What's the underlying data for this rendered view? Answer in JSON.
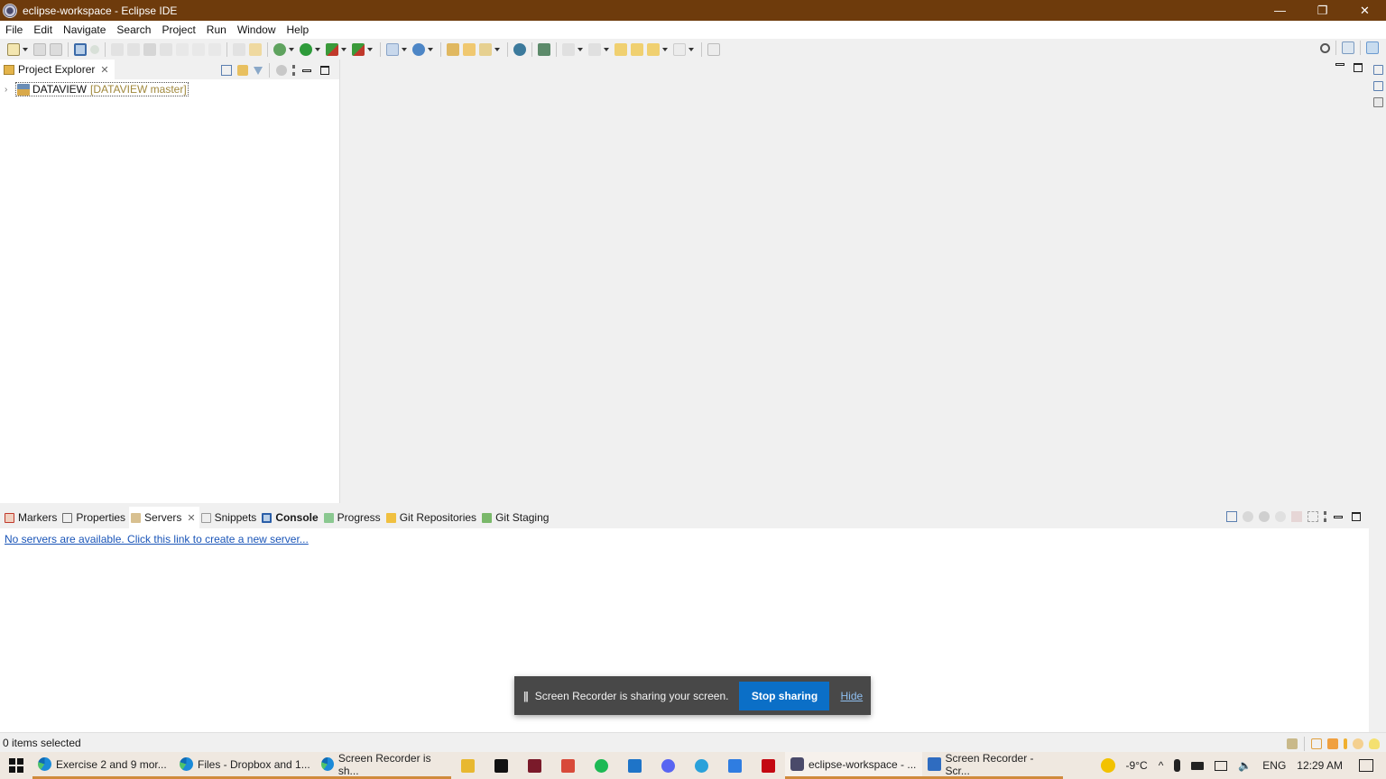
{
  "window": {
    "title": "eclipse-workspace - Eclipse IDE",
    "controls": {
      "minimize": "—",
      "restore": "❐",
      "close": "✕"
    }
  },
  "menu": {
    "items": [
      "File",
      "Edit",
      "Navigate",
      "Search",
      "Project",
      "Run",
      "Window",
      "Help"
    ]
  },
  "toolbar": {
    "left_icons": [
      "new-icon",
      "save-icon",
      "save-all-icon",
      "terminal-icon",
      "skip-breakpoints-icon",
      "resume-icon",
      "suspend-icon",
      "terminate-icon",
      "disconnect-icon",
      "step-into-icon",
      "step-over-icon",
      "step-return-icon",
      "drop-to-frame-icon",
      "use-step-filters-icon",
      "debug-icon",
      "run-icon",
      "run-coverage-icon",
      "external-tools-icon",
      "new-java-project-icon",
      "new-java-class-icon",
      "open-type-icon",
      "open-task-icon",
      "search-tool-icon",
      "web-browser-icon",
      "git-icon",
      "next-annotation-icon",
      "previous-annotation-icon",
      "last-edit-icon",
      "forward-history-icon",
      "back-icon",
      "forward-icon",
      "pin-editor-icon"
    ],
    "right_icons": [
      "search-icon",
      "open-perspective-icon",
      "java-ee-perspective-icon"
    ]
  },
  "explorer": {
    "tab_label": "Project Explorer",
    "tree": [
      {
        "name": "DATAVIEW",
        "decoration": "[DATAVIEW master]",
        "expanded": false
      }
    ]
  },
  "bottom_panel": {
    "tabs": [
      {
        "label": "Markers",
        "active": false,
        "bold": false,
        "closable": false,
        "color": "#c0392b"
      },
      {
        "label": "Properties",
        "active": false,
        "bold": false,
        "closable": false,
        "color": "#6c6c6c"
      },
      {
        "label": "Servers",
        "active": true,
        "bold": false,
        "closable": true,
        "color": "#b08030"
      },
      {
        "label": "Snippets",
        "active": false,
        "bold": false,
        "closable": false,
        "color": "#7a7a7a"
      },
      {
        "label": "Console",
        "active": false,
        "bold": true,
        "closable": false,
        "color": "#2b5fa8"
      },
      {
        "label": "Progress",
        "active": false,
        "bold": false,
        "closable": false,
        "color": "#3a9a4a"
      },
      {
        "label": "Git Repositories",
        "active": false,
        "bold": false,
        "closable": false,
        "color": "#e0a628"
      },
      {
        "label": "Git Staging",
        "active": false,
        "bold": false,
        "closable": false,
        "color": "#4a8a3a"
      }
    ],
    "servers_link": "No servers are available. Click this link to create a new server..."
  },
  "status": {
    "text": "0 items selected"
  },
  "share_banner": {
    "message": "Screen Recorder is sharing your screen.",
    "stop_label": "Stop sharing",
    "hide_label": "Hide"
  },
  "taskbar": {
    "tasks_left": [
      {
        "label": "Exercise 2 and 9 mor...",
        "icon": "edge-icon"
      },
      {
        "label": "Files - Dropbox and 1...",
        "icon": "edge-icon"
      },
      {
        "label": "Screen Recorder is sh...",
        "icon": "edge-icon"
      }
    ],
    "pinned": [
      {
        "name": "file-explorer-icon",
        "color": "#e8b830"
      },
      {
        "name": "cursor-app-icon",
        "color": "#111111"
      },
      {
        "name": "vivaldi-icon",
        "color": "#7a1a2a"
      },
      {
        "name": "gmail-icon",
        "color": "#d84a3a"
      },
      {
        "name": "spotify-icon",
        "color": "#1db954"
      },
      {
        "name": "vscode-icon",
        "color": "#1e74c8"
      },
      {
        "name": "discord-icon",
        "color": "#5865f2"
      },
      {
        "name": "telegram-icon",
        "color": "#2aa1da"
      },
      {
        "name": "todo-icon",
        "color": "#2f7de1"
      },
      {
        "name": "netflix-icon",
        "color": "#c40812"
      }
    ],
    "tasks_right": [
      {
        "label": "eclipse-workspace - ...",
        "icon": "eclipse-icon",
        "active": true
      },
      {
        "label": "Screen Recorder - Scr...",
        "icon": "screen-recorder-icon",
        "active": false
      }
    ],
    "tray": {
      "temperature": "-9°C",
      "language": "ENG",
      "time": "12:29 AM"
    }
  }
}
